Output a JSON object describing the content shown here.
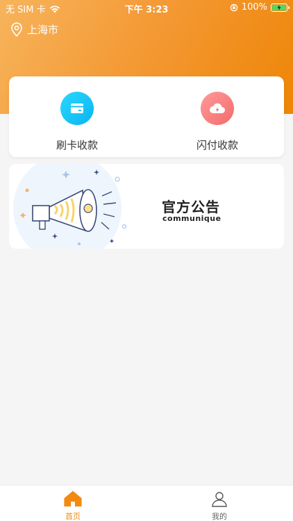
{
  "status_bar": {
    "carrier": "无 SIM 卡",
    "time": "下午 3:23",
    "battery_percent": "100%"
  },
  "location": {
    "city": "上海市"
  },
  "actions": [
    {
      "label": "刷卡收款",
      "icon": "card-icon",
      "color": "#12c3f6"
    },
    {
      "label": "闪付收款",
      "icon": "cloud-lightning-icon",
      "color": "#f77c7c"
    }
  ],
  "notice": {
    "title": "官方公告",
    "subtitle": "communique",
    "icon": "megaphone-icon"
  },
  "tabbar": {
    "items": [
      {
        "label": "首页",
        "icon": "home-icon",
        "active": true
      },
      {
        "label": "我的",
        "icon": "user-icon",
        "active": false
      }
    ],
    "active_color": "#f28a10",
    "inactive_color": "#666666"
  },
  "colors": {
    "header_start": "#f7b45c",
    "header_end": "#ee8506",
    "background": "#f5f5f5"
  }
}
